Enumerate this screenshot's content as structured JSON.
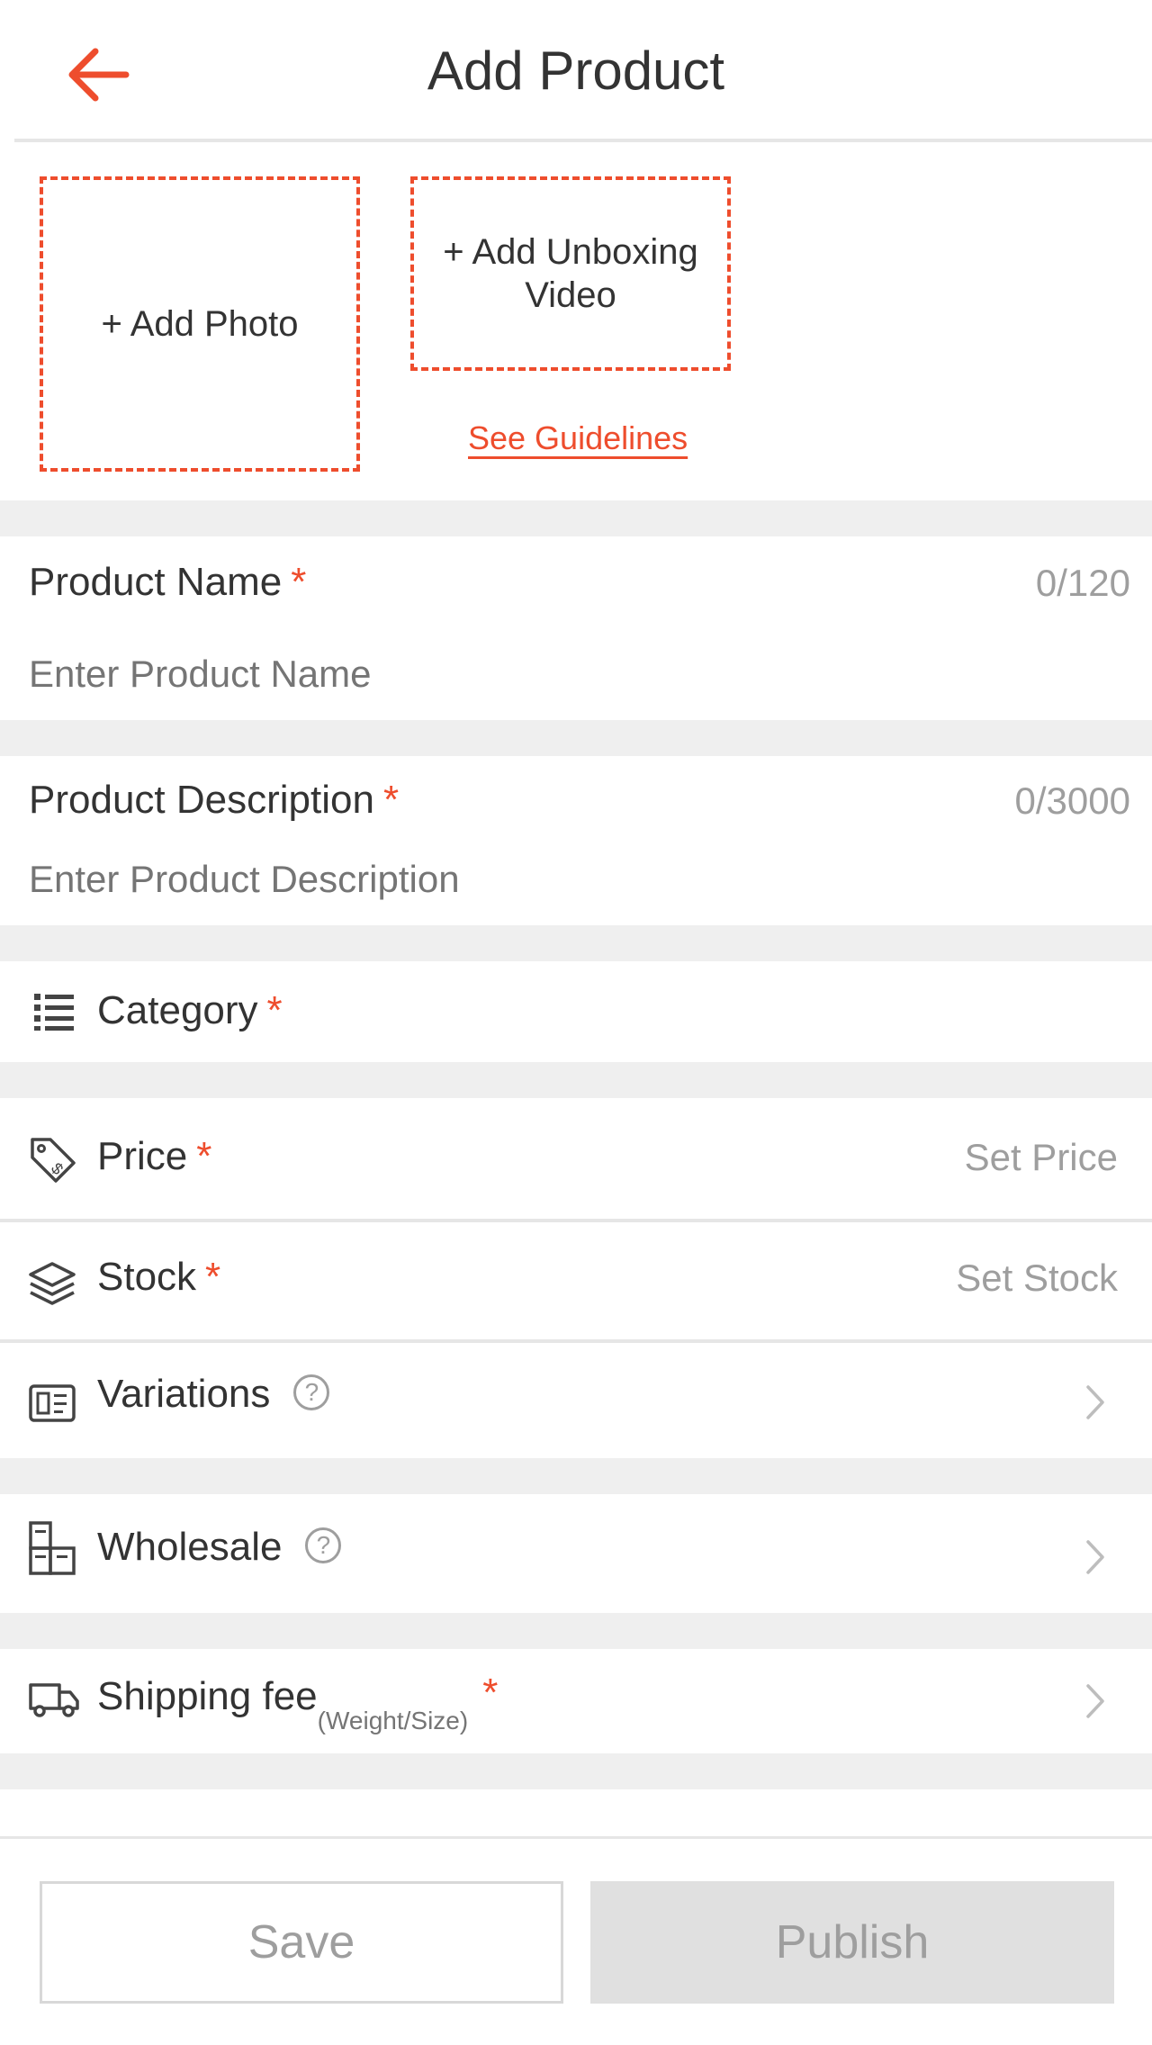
{
  "header": {
    "title": "Add Product",
    "back_icon": "arrow-left-icon",
    "accent_color": "#ee4d2d"
  },
  "media": {
    "add_photo_label": "+ Add Photo",
    "add_video_label": "+ Add Unboxing Video",
    "guidelines_link": "See Guidelines"
  },
  "product_name": {
    "label": "Product Name",
    "required_mark": "*",
    "counter": "0/120",
    "placeholder": "Enter Product Name"
  },
  "product_description": {
    "label": "Product Description",
    "required_mark": "*",
    "counter": "0/3000",
    "placeholder": "Enter Product Description"
  },
  "category": {
    "label": "Category",
    "required_mark": "*",
    "icon": "list-icon"
  },
  "price": {
    "label": "Price",
    "required_mark": "*",
    "value_placeholder": "Set Price",
    "icon": "price-tag-icon"
  },
  "stock": {
    "label": "Stock",
    "required_mark": "*",
    "value_placeholder": "Set Stock",
    "icon": "layers-icon"
  },
  "variations": {
    "label": "Variations",
    "help_glyph": "?",
    "icon": "variations-card-icon"
  },
  "wholesale": {
    "label": "Wholesale",
    "help_glyph": "?",
    "icon": "wholesale-boxes-icon"
  },
  "shipping": {
    "label": "Shipping fee",
    "sublabel": "(Weight/Size)",
    "required_mark": "*",
    "icon": "truck-icon"
  },
  "footer": {
    "save_label": "Save",
    "publish_label": "Publish"
  }
}
